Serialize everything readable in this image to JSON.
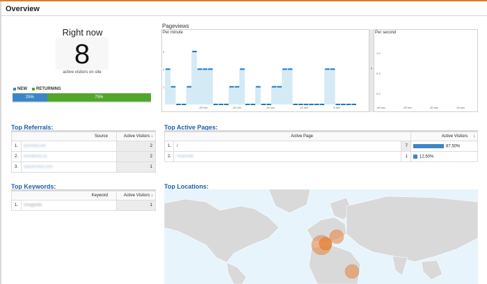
{
  "page": {
    "title": "Overview"
  },
  "right_now": {
    "title": "Right now",
    "active_visitors": "8",
    "caption": "active visitors on site",
    "legend_new": "NEW",
    "legend_returning": "RETURNING",
    "new_percent_label": "25%",
    "returning_percent_label": "75%",
    "new_fraction": 0.25,
    "colors": {
      "new": "#3d85c6",
      "returning": "#52a62a"
    }
  },
  "pageviews": {
    "title": "Pageviews",
    "per_minute_label": "Per minute",
    "per_second_label": "Per second",
    "arrow": "›",
    "minute_y_ticks": [
      "3",
      "2",
      "1"
    ],
    "minute_x_ticks": [
      "-25 min",
      "-20 min",
      "-15 min",
      "-10 min",
      "-5 min"
    ],
    "second_y_ticks": [
      "1.0",
      "0.5",
      "0.0"
    ],
    "second_x_ticks": [
      "-60 sec",
      "-45 sec",
      "-30 sec",
      "-15 sec"
    ],
    "chart_data": {
      "type": "bar",
      "title": "Pageviews",
      "ylim": [
        0,
        3
      ],
      "series": [
        {
          "values": [
            2,
            1,
            0,
            0,
            1,
            3,
            2,
            2,
            2,
            0,
            0,
            0,
            1,
            1,
            2,
            0,
            0,
            1,
            0,
            0,
            1,
            1,
            2,
            2,
            0,
            0,
            0,
            0,
            0,
            0,
            2,
            2,
            0,
            0,
            0,
            0
          ]
        }
      ]
    }
  },
  "top_referrals": {
    "title": "Top Referrals:",
    "col_source": "Source",
    "col_visitors": "Active Visitors",
    "sort_arrow": "↓",
    "rows": [
      {
        "index": "1.",
        "source": "quickfav.net",
        "visitors": "2"
      },
      {
        "index": "2.",
        "source": "trendfront.co",
        "visitors": "2"
      },
      {
        "index": "3.",
        "source": "spacecrest.com",
        "visitors": "1"
      }
    ]
  },
  "top_keywords": {
    "title": "Top Keywords:",
    "col_keyword": "Keyword",
    "col_visitors": "Active Visitors",
    "sort_arrow": "↓",
    "rows": [
      {
        "index": "1.",
        "keyword": "vmagtsbb",
        "visitors": "1"
      }
    ]
  },
  "top_active_pages": {
    "title": "Top Active Pages:",
    "col_page": "Active Page",
    "col_visitors": "Active Visitors",
    "sort_arrow": "↓",
    "rows": [
      {
        "index": "1.",
        "page": "/",
        "visitors": "7",
        "percent": "87.50%",
        "fraction": 0.875
      },
      {
        "index": "2.",
        "page": "/mainsite",
        "visitors": "1",
        "percent": "12.50%",
        "fraction": 0.125
      }
    ]
  },
  "top_locations": {
    "title": "Top Locations:",
    "colors": {
      "water": "#e8f4fb",
      "land": "#d9d9d9",
      "bubble": "#e8833a"
    }
  }
}
